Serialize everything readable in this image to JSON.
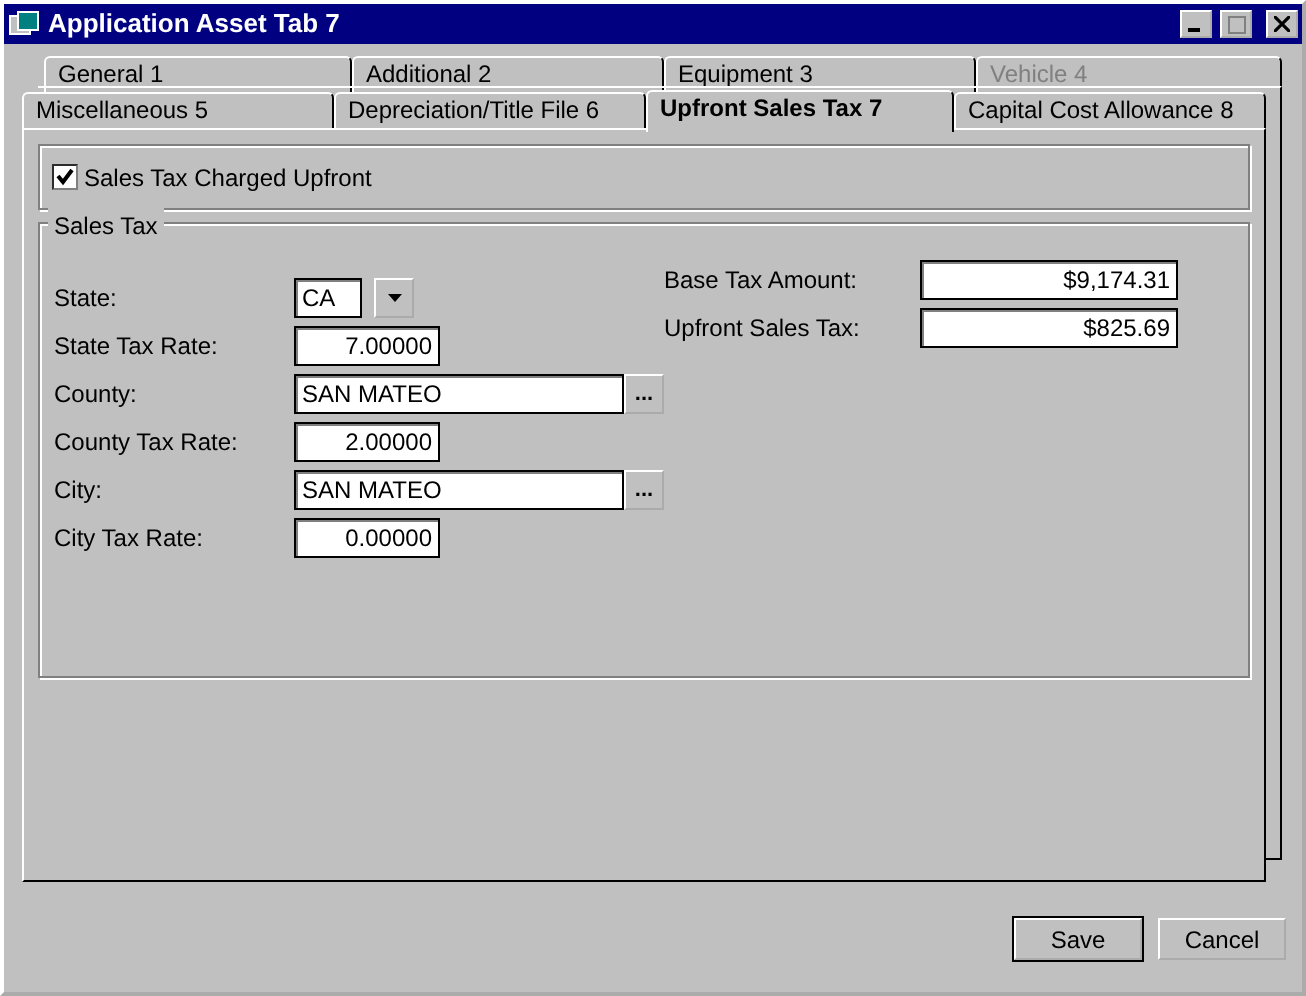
{
  "window": {
    "title": "Application Asset Tab 7"
  },
  "tab_rows": [
    [
      {
        "label": "General 1",
        "selected": false,
        "disabled": false
      },
      {
        "label": "Additional 2",
        "selected": false,
        "disabled": false
      },
      {
        "label": "Equipment 3",
        "selected": false,
        "disabled": false
      },
      {
        "label": "Vehicle 4",
        "selected": false,
        "disabled": true
      }
    ],
    [
      {
        "label": "Miscellaneous 5",
        "selected": false,
        "disabled": false
      },
      {
        "label": "Depreciation/Title File 6",
        "selected": false,
        "disabled": false
      },
      {
        "label": "Upfront Sales Tax 7",
        "selected": true,
        "disabled": false
      },
      {
        "label": "Capital Cost Allowance 8",
        "selected": false,
        "disabled": false
      }
    ]
  ],
  "upfront_checkbox": {
    "label": "Sales Tax Charged Upfront",
    "checked": true
  },
  "sales_tax": {
    "title": "Sales Tax",
    "fields": [
      {
        "kind": "dropdown",
        "label": "State:",
        "value": "CA"
      },
      {
        "kind": "number",
        "label": "State Tax Rate:",
        "value": "7.00000"
      },
      {
        "kind": "lookup",
        "label": "County:",
        "value": "SAN MATEO",
        "button": "..."
      },
      {
        "kind": "number",
        "label": "County Tax Rate:",
        "value": "2.00000"
      },
      {
        "kind": "lookup",
        "label": "City:",
        "value": "SAN MATEO",
        "button": "..."
      },
      {
        "kind": "number",
        "label": "City Tax Rate:",
        "value": "0.00000"
      }
    ],
    "totals": [
      {
        "label": "Base Tax Amount:",
        "value": "$9,174.31"
      },
      {
        "label": "Upfront Sales Tax:",
        "value": "$825.69"
      }
    ]
  },
  "buttons": [
    {
      "label": "Save",
      "default": true
    },
    {
      "label": "Cancel",
      "default": false
    }
  ]
}
